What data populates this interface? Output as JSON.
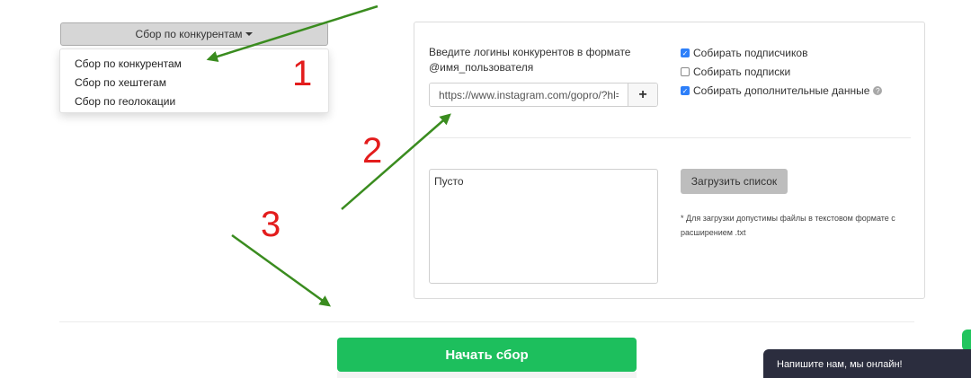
{
  "dropdown": {
    "selected_label": "Сбор по конкурентам",
    "items": [
      "Сбор по конкурентам",
      "Сбор по хештегам",
      "Сбор по геолокации"
    ]
  },
  "annotations": {
    "step1": "1",
    "step2": "2",
    "step3": "3",
    "arrow_color": "#3a8c1f",
    "number_color": "#e31c1c"
  },
  "form": {
    "logins_label": "Введите логины конкурентов в формате @имя_пользователя",
    "url_input_value": "https://www.instagram.com/gopro/?hl=",
    "add_button_icon": "plus-icon",
    "checkboxes": [
      {
        "label": "Собирать подписчиков",
        "checked": true
      },
      {
        "label": "Собирать подписки",
        "checked": false
      },
      {
        "label": "Собирать дополнительные данные",
        "checked": true
      }
    ],
    "list_textarea_value": "Пусто",
    "upload_button_label": "Загрузить список",
    "upload_note": "* Для загрузки допустимы файлы в текстовом формате с расширением .txt"
  },
  "actions": {
    "start_button_label": "Начать сбор",
    "start_button_color": "#1dbf5d"
  },
  "chat": {
    "label": "Напишите нам, мы онлайн!"
  }
}
